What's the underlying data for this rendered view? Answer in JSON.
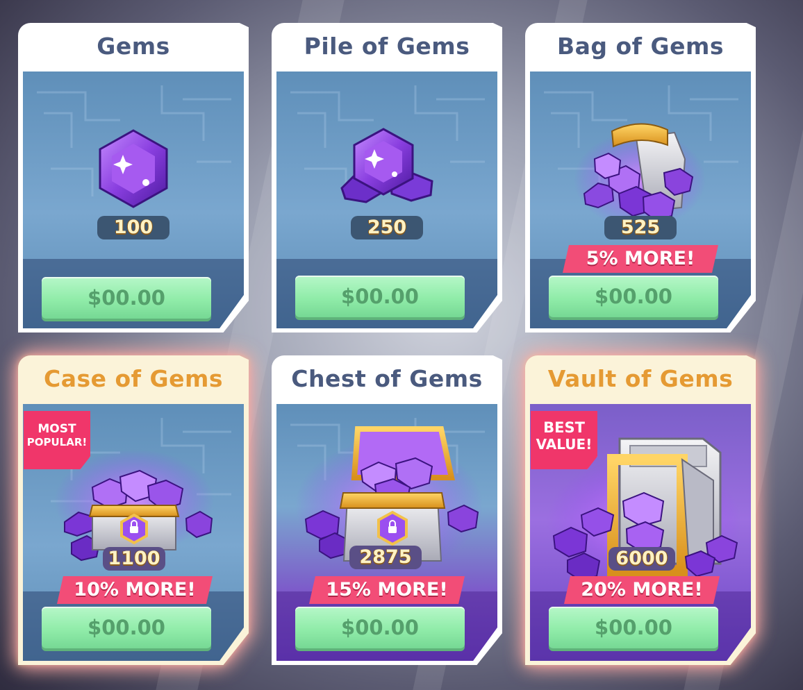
{
  "packs": [
    {
      "title": "Gems",
      "count": "100",
      "bonus": "",
      "price": "$00.00",
      "ribbon": ""
    },
    {
      "title": "Pile of Gems",
      "count": "250",
      "bonus": "",
      "price": "$00.00",
      "ribbon": ""
    },
    {
      "title": "Bag of Gems",
      "count": "525",
      "bonus": "5% MORE!",
      "price": "$00.00",
      "ribbon": ""
    },
    {
      "title": "Case of Gems",
      "count": "1100",
      "bonus": "10% MORE!",
      "price": "$00.00",
      "ribbon": "MOST POPULAR!"
    },
    {
      "title": "Chest of Gems",
      "count": "2875",
      "bonus": "15% MORE!",
      "price": "$00.00",
      "ribbon": ""
    },
    {
      "title": "Vault of Gems",
      "count": "6000",
      "bonus": "20% MORE!",
      "price": "$00.00",
      "ribbon": "BEST VALUE!"
    }
  ],
  "ribbons": {
    "popular_line1": "MOST",
    "popular_line2": "POPULAR!",
    "value_line1": "BEST",
    "value_line2": "VALUE!"
  },
  "colors": {
    "title": "#4a5a7e",
    "featured_title": "#e59a33",
    "bonus": "#f24d77",
    "price_button": "#90eca9",
    "gem": "#8a3fe0"
  },
  "icons": [
    "gem-icon",
    "gem-pile-icon",
    "gem-bag-icon",
    "gem-case-icon",
    "gem-chest-icon",
    "gem-vault-icon"
  ]
}
